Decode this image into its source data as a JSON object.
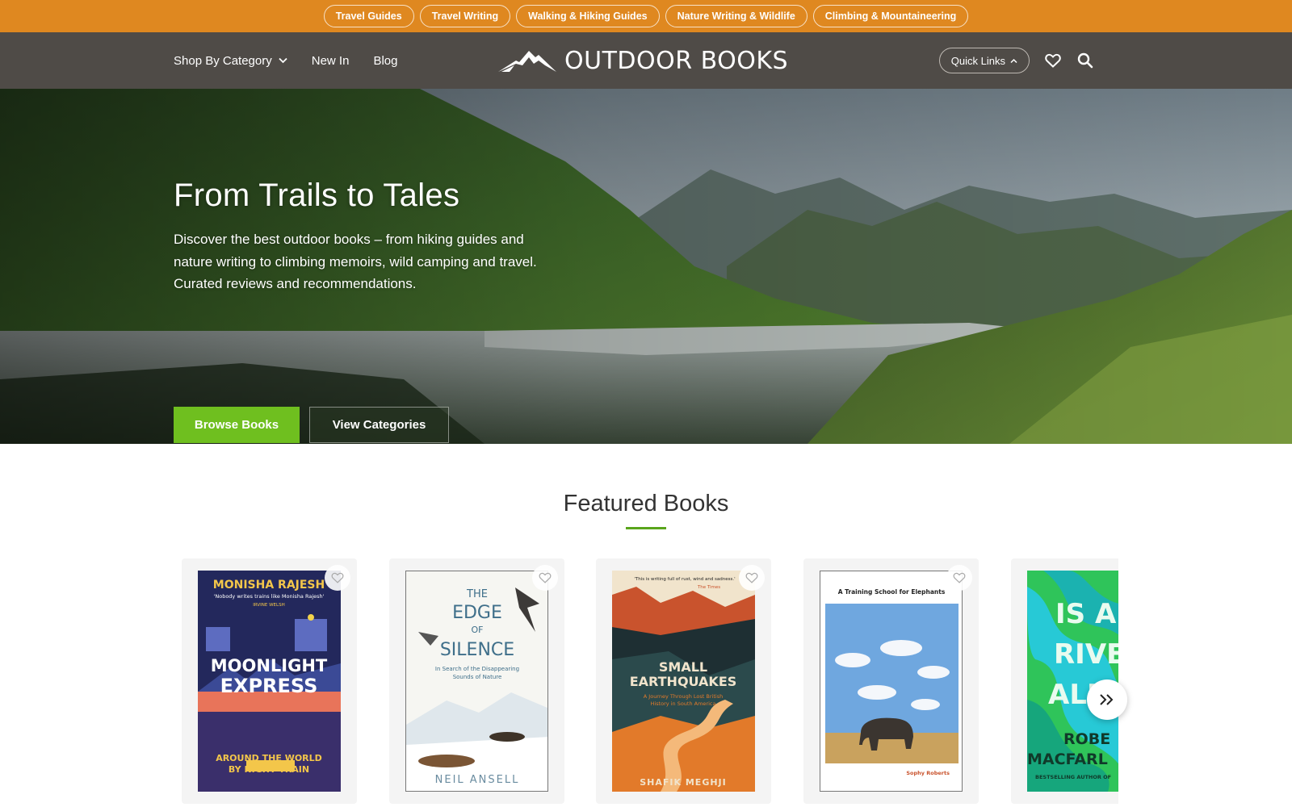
{
  "topbar": {
    "chips": [
      "Travel Guides",
      "Travel Writing",
      "Walking & Hiking Guides",
      "Nature Writing & Wildlife",
      "Climbing & Mountaineering"
    ]
  },
  "nav": {
    "shop_by_category": "Shop By Category",
    "new_in": "New In",
    "blog": "Blog",
    "logo": "OUTDOOR BOOKS",
    "quick_links": "Quick Links"
  },
  "hero": {
    "title": "From Trails to Tales",
    "description": "Discover the best outdoor books – from hiking guides and nature writing to climbing memoirs, wild camping and travel. Curated reviews and recommendations.",
    "browse_button": "Browse Books",
    "categories_button": "View Categories"
  },
  "featured": {
    "title": "Featured Books",
    "books": [
      {
        "author": "MONISHA RAJESH",
        "quote": "'Nobody writes trains like Monisha Rajesh'",
        "quote_source": "IRVINE WELSH",
        "title_line1": "MOONLIGHT",
        "title_line2": "EXPRESS",
        "subtitle_line1": "AROUND THE WORLD",
        "subtitle_line2": "BY NIGHT TRAIN"
      },
      {
        "title_line1": "THE",
        "title_line2": "EDGE",
        "title_line3": "OF",
        "title_line4": "SILENCE",
        "subtitle_line1": "In Search of the Disappearing",
        "subtitle_line2": "Sounds of Nature",
        "author": "NEIL ANSELL"
      },
      {
        "quote": "'This is writing full of rust, wind and sadness.'",
        "quote_source": "The Times",
        "title_line1": "SMALL",
        "title_line2": "EARTHQUAKES",
        "subtitle_line1": "A Journey Through Lost British",
        "subtitle_line2": "History in South America",
        "author": "SHAFIK MEGHJI"
      },
      {
        "title": "A Training School for Elephants",
        "author": "Sophy Roberts"
      },
      {
        "title_line1": "IS A",
        "title_line2": "RIVE",
        "title_line3": "ALI",
        "author_line1": "ROBE",
        "author_line2": "MACFARL",
        "tagline": "BESTSELLING AUTHOR OF"
      }
    ]
  },
  "colors": {
    "topbar": "#df8820",
    "navbar": "#4f4b47",
    "primary_button": "#6fbf1f",
    "accent_underline": "#5aa51c"
  }
}
